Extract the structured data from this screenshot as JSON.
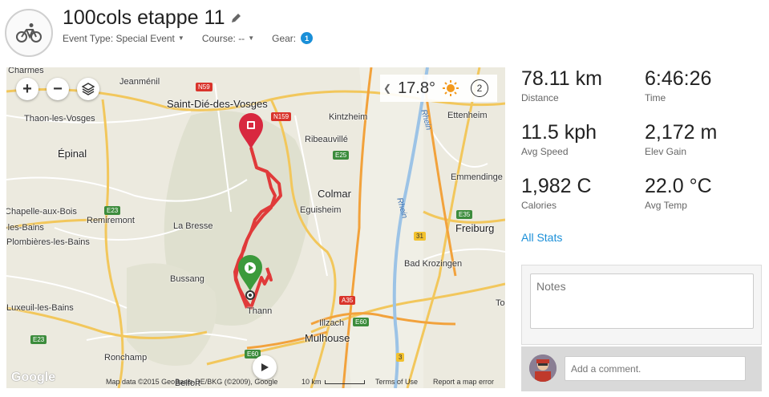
{
  "header": {
    "title": "100cols etappe 11",
    "event_type_label": "Event Type:",
    "event_type_value": "Special Event",
    "course_label": "Course:",
    "course_value": "--",
    "gear_label": "Gear:",
    "gear_count": "1",
    "activity_icon": "bicycle-icon",
    "edit_icon": "pencil-icon"
  },
  "map": {
    "weather_temp": "17.8°",
    "weather_icon": "sun-icon",
    "wind_value": "2",
    "zoom_in": "+",
    "zoom_out": "−",
    "layers_icon": "layers-icon",
    "labels": {
      "charmes": "Charmes",
      "jeanmenil": "Jeanménil",
      "saint_die": "Saint-Dié-des-Vosges",
      "thaon": "Thaon-les-Vosges",
      "kintzheim": "Kintzheim",
      "ettenheim": "Ettenheim",
      "ribeauville": "Ribeauvillé",
      "epinal": "Épinal",
      "colmar": "Colmar",
      "eguisheim": "Eguisheim",
      "emmendingen": "Emmendinge",
      "chapelle": "Chapelle-aux-Bois",
      "remiremont": "Remiremont",
      "les_bains": "-les-Bains",
      "plombieres": "Plombières-les-Bains",
      "la_bresse": "La Bresse",
      "freiburg": "Freiburg",
      "bad_krozingen": "Bad Krozingen",
      "bussang": "Bussang",
      "thann": "Thann",
      "luxeuil": "Luxeuil-les-Bains",
      "illzach": "Illzach",
      "mulhouse": "Mulhouse",
      "ronchamp": "Ronchamp",
      "belfort": "Belfort",
      "rhein": "Rhein",
      "rhein2": "Rhein",
      "toc": "Toc",
      "n59": "N59",
      "n159": "N159",
      "e25": "E25",
      "e23": "E23",
      "e23b": "E23",
      "e35": "E35",
      "n31": "31",
      "a35": "A35",
      "e60": "E60",
      "e60b": "E60",
      "n3": "3"
    },
    "footer": {
      "google": "Google",
      "map_data": "Map data ©2015 GeoBasis-DE/BKG (©2009), Google",
      "scale": "10 km",
      "terms": "Terms of Use",
      "report": "Report a map error"
    }
  },
  "stats": {
    "distance_value": "78.11 km",
    "distance_label": "Distance",
    "time_value": "6:46:26",
    "time_label": "Time",
    "speed_value": "11.5 kph",
    "speed_label": "Avg Speed",
    "elev_value": "2,172 m",
    "elev_label": "Elev Gain",
    "calories_value": "1,982 C",
    "calories_label": "Calories",
    "temp_value": "22.0 °C",
    "temp_label": "Avg Temp",
    "all_stats_link": "All Stats"
  },
  "notes": {
    "placeholder": "Notes"
  },
  "comment": {
    "placeholder": "Add a comment."
  },
  "colors": {
    "accent": "#1a8fd8",
    "route": "#e03a3a",
    "start_pin": "#3c9a3c",
    "end_pin": "#d8283f"
  }
}
